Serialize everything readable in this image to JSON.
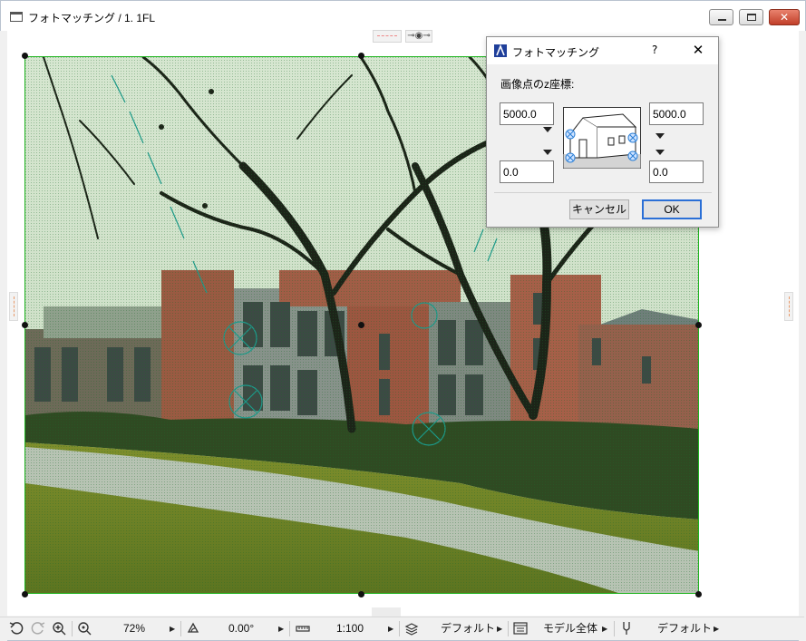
{
  "window": {
    "title": "フォトマッチング / 1. 1FL"
  },
  "dialog": {
    "title": "フォトマッチング",
    "help_label": "?",
    "close_label": "✕",
    "prompt": "画像点のz座標:",
    "top_left_value": "5000.0",
    "top_right_value": "5000.0",
    "bottom_left_value": "0.0",
    "bottom_right_value": "0.0",
    "cancel_label": "キャンセル",
    "ok_label": "OK"
  },
  "canvas_tabs": {
    "eye_label": "⊸◉⊸"
  },
  "toolbar": {
    "zoom_value": "72%",
    "angle_value": "0.00°",
    "scale_value": "1:100",
    "layer_value": "デフォルト",
    "model_value": "モデル全体",
    "pen_value": "デフォルト"
  },
  "colors": {
    "selection_border": "#1fb41f",
    "ok_focus": "#2a6fd6"
  },
  "icons": [
    "window-icon",
    "minimize-icon",
    "maximize-icon",
    "close-icon",
    "undo-icon",
    "redo-icon",
    "zoom-in-icon",
    "zoom-fit-icon",
    "rotate-icon",
    "scale-icon",
    "layers-icon",
    "model-view-icon",
    "pen-icon",
    "house-icon",
    "archicad-icon"
  ]
}
